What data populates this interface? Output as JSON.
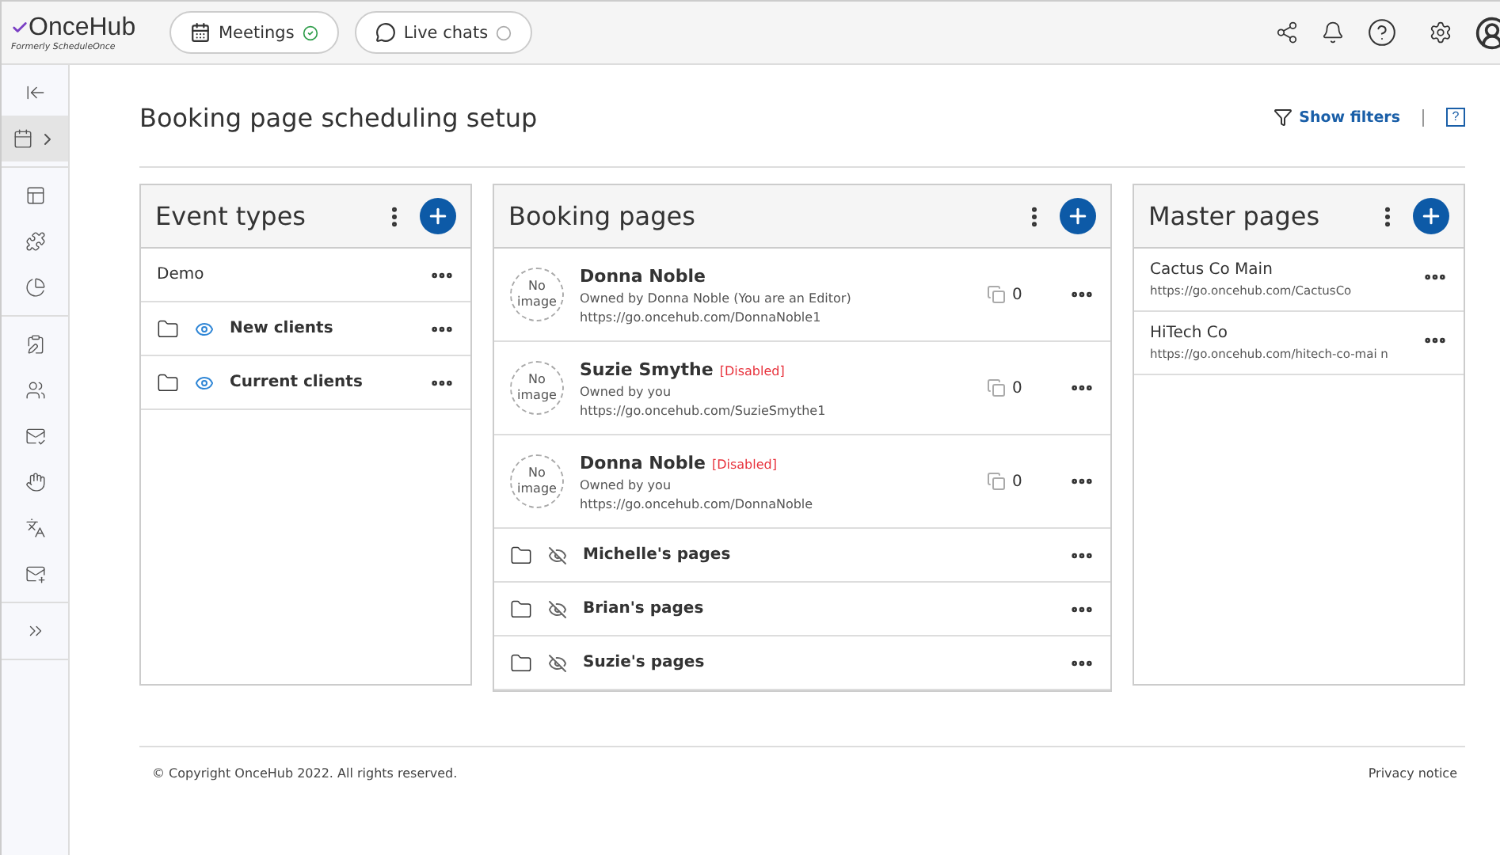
{
  "header": {
    "logo": "OnceHub",
    "logo_sub": "Formerly ScheduleOnce",
    "products": [
      {
        "label": "Meetings",
        "connected": true
      },
      {
        "label": "Live chats",
        "connected": false
      }
    ]
  },
  "sidebar": {
    "groups": [
      {
        "items": [
          {
            "selected": false
          },
          {
            "selected": true
          }
        ]
      },
      {
        "items": [
          {
            "selected": false
          },
          {
            "selected": false
          },
          {
            "selected": false
          }
        ]
      },
      {
        "items": [
          {
            "selected": false
          },
          {
            "selected": false
          },
          {
            "selected": false
          },
          {
            "selected": false
          },
          {
            "selected": false
          },
          {
            "selected": false
          }
        ]
      },
      {
        "items": [
          {
            "selected": false
          }
        ]
      }
    ]
  },
  "page": {
    "title": "Booking page scheduling setup",
    "filters_link": "Show filters",
    "help": "?"
  },
  "panels": [
    {
      "title": "Event types",
      "rows": [
        {
          "kind": "item",
          "name": "Demo"
        },
        {
          "kind": "folder",
          "name": "New clients",
          "visible": true
        },
        {
          "kind": "folder",
          "name": "Current clients",
          "visible": true
        }
      ]
    },
    {
      "title": "Booking pages",
      "rows": [
        {
          "kind": "page",
          "image": "No image",
          "name": "Donna Noble",
          "tag": "",
          "owner": "Owned by Donna Noble (You are an Editor)",
          "url": "https://go.oncehub.com/DonnaNoble1",
          "count": "0"
        },
        {
          "kind": "page",
          "image": "No image",
          "name": "Suzie Smythe",
          "tag": "[Disabled]",
          "owner": "Owned by you",
          "url": "https://go.oncehub.com/SuzieSmythe1",
          "count": "0"
        },
        {
          "kind": "page",
          "image": "No image",
          "name": "Donna Noble",
          "tag": "[Disabled]",
          "owner": "Owned by you",
          "url": "https://go.oncehub.com/DonnaNoble",
          "count": "0"
        },
        {
          "kind": "folder",
          "name": "Michelle's pages",
          "visible": false
        },
        {
          "kind": "folder",
          "name": "Brian's pages",
          "visible": false
        },
        {
          "kind": "folder",
          "name": "Suzie's pages",
          "visible": false
        }
      ]
    },
    {
      "title": "Master pages",
      "rows": [
        {
          "kind": "master",
          "name": "Cactus Co Main",
          "url": "https://go.oncehub.com/CactusCo"
        },
        {
          "kind": "master",
          "name": "HiTech Co",
          "url": "https://go.oncehub.com/hitech-co-mai n"
        }
      ]
    }
  ],
  "footer": {
    "copyright": "© Copyright OnceHub 2022. All rights reserved.",
    "privacy": "Privacy notice"
  }
}
